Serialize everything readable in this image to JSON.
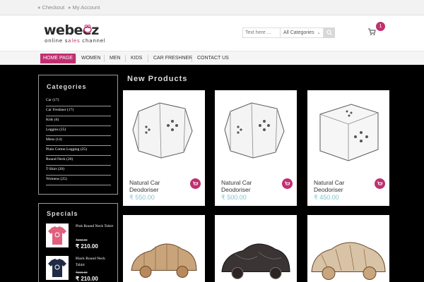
{
  "topbar": {
    "links": [
      "Checkout",
      "My Account"
    ]
  },
  "brand": {
    "name": "webeez",
    "tagline": "online sales channel"
  },
  "search": {
    "placeholder": "Text here ...",
    "category": "All Categories"
  },
  "cart": {
    "count": "1"
  },
  "nav": {
    "items": [
      "HOME PAGE",
      "WOMEN",
      "MEN",
      "KIDS",
      "CAR FRESHNER",
      "CONTACT US"
    ],
    "active": "HOME PAGE"
  },
  "categories": {
    "title": "Categories",
    "items": [
      "Car (17)",
      "Car Freshner (17)",
      "Kids (6)",
      "Leggins (25)",
      "Mens (14)",
      "Plain Cotton Legging (25)",
      "Round Neck (20)",
      "T-Shirt (20)",
      "Womens (25)"
    ]
  },
  "specials": {
    "title": "Specials",
    "items": [
      {
        "name": "Pink Round Neck Tshirt",
        "old_price": "₹200.00",
        "price": "₹ 210.00"
      },
      {
        "name": "Black Round Neck Tshirt",
        "old_price": "₹200.00",
        "price": "₹ 210.00"
      }
    ]
  },
  "products": {
    "title": "New Products",
    "items": [
      {
        "name": "Natural Car Deodoriser",
        "price": "₹ 550.00"
      },
      {
        "name": "Natural Car Deodoriser",
        "price": "₹ 500.00"
      },
      {
        "name": "Natural Car Deodoriser",
        "price": "₹ 450.00"
      }
    ]
  },
  "colors": {
    "accent": "#c0306f",
    "price": "#7ec4d0",
    "background": "#000000"
  }
}
